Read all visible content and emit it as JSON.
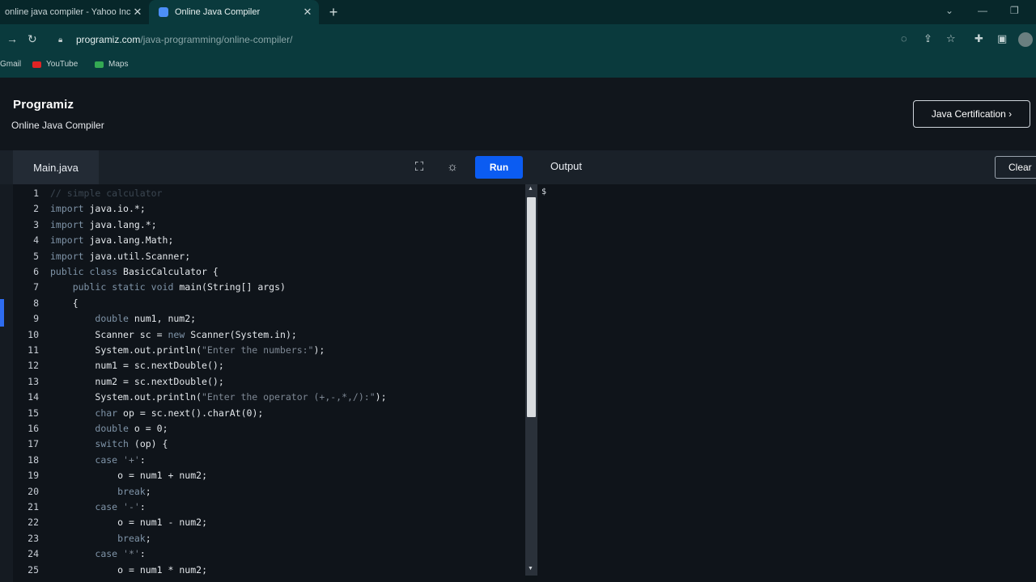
{
  "browser": {
    "tabs": [
      {
        "title": "online java compiler - Yahoo Inc",
        "active": false
      },
      {
        "title": "Online Java Compiler",
        "active": true
      }
    ],
    "new_tab": "+",
    "url_host": "programiz.com",
    "url_path": "/java-programming/online-compiler/",
    "bookmarks": [
      "Gmail",
      "YouTube",
      "Maps"
    ]
  },
  "site": {
    "logo": "Programiz",
    "subtitle": "Online Java Compiler",
    "cert_button": "Java Certification ›"
  },
  "toolbar": {
    "file_tab": "Main.java",
    "run_label": "Run",
    "output_label": "Output",
    "clear_label": "Clear"
  },
  "output": {
    "prompt": "$"
  },
  "code_lines": [
    {
      "n": "1",
      "text": "// simple calculator"
    },
    {
      "n": "2",
      "text": "import java.io.*;"
    },
    {
      "n": "3",
      "text": "import java.lang.*;"
    },
    {
      "n": "4",
      "text": "import java.lang.Math;"
    },
    {
      "n": "5",
      "text": "import java.util.Scanner;"
    },
    {
      "n": "6",
      "text": "public class BasicCalculator {"
    },
    {
      "n": "7",
      "text": "    public static void main(String[] args)"
    },
    {
      "n": "8",
      "text": "    {"
    },
    {
      "n": "9",
      "text": "        double num1, num2;"
    },
    {
      "n": "10",
      "text": "        Scanner sc = new Scanner(System.in);"
    },
    {
      "n": "11",
      "text": "        System.out.println(\"Enter the numbers:\");"
    },
    {
      "n": "12",
      "text": "        num1 = sc.nextDouble();"
    },
    {
      "n": "13",
      "text": "        num2 = sc.nextDouble();"
    },
    {
      "n": "14",
      "text": "        System.out.println(\"Enter the operator (+,-,*,/):\");"
    },
    {
      "n": "15",
      "text": "        char op = sc.next().charAt(0);"
    },
    {
      "n": "16",
      "text": "        double o = 0;"
    },
    {
      "n": "17",
      "text": "        switch (op) {"
    },
    {
      "n": "18",
      "text": "        case '+':"
    },
    {
      "n": "19",
      "text": "            o = num1 + num2;"
    },
    {
      "n": "20",
      "text": "            break;"
    },
    {
      "n": "21",
      "text": "        case '-':"
    },
    {
      "n": "22",
      "text": "            o = num1 - num2;"
    },
    {
      "n": "23",
      "text": "            break;"
    },
    {
      "n": "24",
      "text": "        case '*':"
    },
    {
      "n": "25",
      "text": "            o = num1 * num2;"
    }
  ],
  "colors": {
    "run_button": "#0b5cf2",
    "chrome_bg": "#0a3a3d",
    "editor_bg": "#0f141a"
  }
}
